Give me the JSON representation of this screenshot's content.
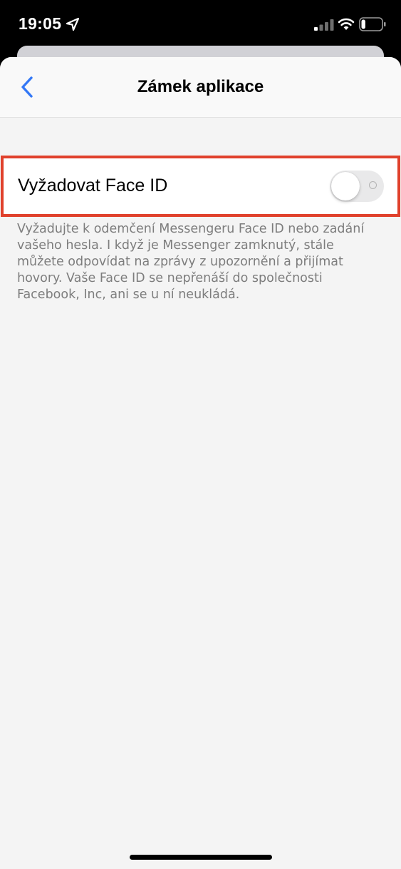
{
  "status_bar": {
    "time": "19:05",
    "location_icon": "location-arrow-icon",
    "signal_icon": "cellular-signal-icon",
    "wifi_icon": "wifi-icon",
    "battery_icon": "battery-icon",
    "battery_level": 0.2
  },
  "nav": {
    "back_icon": "chevron-left-icon",
    "title": "Zámek aplikace"
  },
  "setting": {
    "label": "Vyžadovat Face ID",
    "toggle_on": false,
    "highlight_color": "#e0412c"
  },
  "description": "Vyžadujte k odemčení Messengeru Face ID nebo zadání vašeho hesla. I když je Messenger zamknutý, stále můžete odpovídat na zprávy z upozornění a přijímat hovory. Vaše Face ID se nepřenáší do společnosti Facebook, Inc, ani se u ní neukládá.",
  "colors": {
    "accent": "#3478f6",
    "background": "#f4f4f4",
    "secondary_text": "#7d7d7d"
  }
}
